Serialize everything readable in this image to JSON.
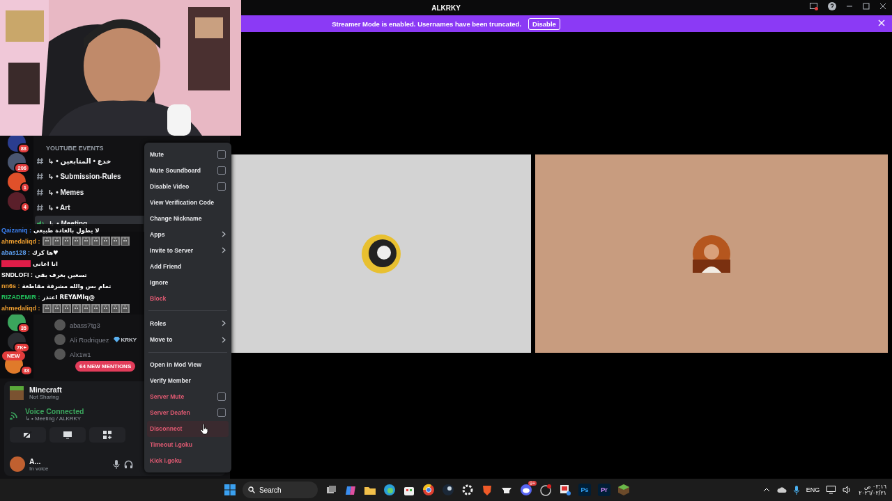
{
  "window": {
    "title": "ALKRKY"
  },
  "banner": {
    "text": "Streamer Mode is enabled. Usernames have been truncated.",
    "button": "Disable"
  },
  "servers": [
    {
      "badge": "88",
      "color": "#2a3d8f"
    },
    {
      "badge": "206",
      "color": "#4a5670"
    },
    {
      "badge": "1",
      "color": "#e0502a"
    },
    {
      "badge": "4",
      "color": "#5a1f2a"
    },
    {
      "badge": "35",
      "color": "#3ba55d"
    },
    {
      "badge": "7K+",
      "color": "#2b2d31"
    },
    {
      "badge": "33",
      "color": "#e07a2a",
      "pill": "NEW"
    }
  ],
  "channels": {
    "category": "YOUTUBE EVENTS",
    "items": [
      {
        "kind": "text",
        "name": "↳ • خدع • المتابعين",
        "selected": false
      },
      {
        "kind": "text",
        "name": "↳ • Submission-Rules",
        "selected": false
      },
      {
        "kind": "text",
        "name": "↳ • Memes",
        "selected": false
      },
      {
        "kind": "text",
        "name": "↳ • Art",
        "selected": false
      },
      {
        "kind": "voice",
        "name": "↳ • Meeting",
        "selected": true
      }
    ]
  },
  "members": [
    {
      "name": "abass7tg3"
    },
    {
      "name": "Ali Rodriquez",
      "tag": "KRKY"
    },
    {
      "name": "Alx1w1"
    }
  ],
  "mentions_pill": "64 NEW MENTIONS",
  "activity": {
    "title": "Minecraft",
    "subtitle": "Not Sharing"
  },
  "voice": {
    "status": "Voice Connected",
    "channel": "↳ • Meeting / ALKRKY"
  },
  "user": {
    "name": "A...",
    "status": "In voice"
  },
  "tiles": [
    {
      "color": "#d3d3d3"
    },
    {
      "color": "#c89c7f"
    }
  ],
  "context_menu": {
    "groups": [
      [
        {
          "label": "Mute",
          "kind": "checkbox",
          "checked": false,
          "danger": false,
          "hovered": false
        },
        {
          "label": "Mute Soundboard",
          "kind": "checkbox",
          "checked": false,
          "danger": false,
          "hovered": false
        },
        {
          "label": "Disable Video",
          "kind": "checkbox",
          "checked": false,
          "danger": false,
          "hovered": false
        },
        {
          "label": "View Verification Code",
          "kind": "action",
          "danger": false,
          "hovered": false
        },
        {
          "label": "Change Nickname",
          "kind": "action",
          "danger": false,
          "hovered": false
        },
        {
          "label": "Apps",
          "kind": "submenu",
          "danger": false,
          "hovered": false
        },
        {
          "label": "Invite to Server",
          "kind": "submenu",
          "danger": false,
          "hovered": false
        },
        {
          "label": "Add Friend",
          "kind": "action",
          "danger": false,
          "hovered": false
        },
        {
          "label": "Ignore",
          "kind": "action",
          "danger": false,
          "hovered": false
        },
        {
          "label": "Block",
          "kind": "action",
          "danger": true,
          "hovered": false
        }
      ],
      [
        {
          "label": "Roles",
          "kind": "submenu",
          "danger": false,
          "hovered": false
        },
        {
          "label": "Move to",
          "kind": "submenu",
          "danger": false,
          "hovered": false
        }
      ],
      [
        {
          "label": "Open in Mod View",
          "kind": "action",
          "danger": false,
          "hovered": false
        },
        {
          "label": "Verify Member",
          "kind": "action",
          "danger": false,
          "hovered": false
        },
        {
          "label": "Server Mute",
          "kind": "checkbox",
          "checked": false,
          "danger": true,
          "hovered": false
        },
        {
          "label": "Server Deafen",
          "kind": "checkbox",
          "checked": false,
          "danger": true,
          "hovered": false
        },
        {
          "label": "Disconnect",
          "kind": "action",
          "danger": true,
          "hovered": true
        },
        {
          "label": "Timeout i.goku",
          "kind": "action",
          "danger": true,
          "hovered": false
        },
        {
          "label": "Kick i.goku",
          "kind": "action",
          "danger": true,
          "hovered": false
        }
      ]
    ]
  },
  "chat": [
    {
      "user": "Qaizaniq :",
      "color": "#3b82f6",
      "kind": "text",
      "message": "لا يطول بالعادة طبيعي"
    },
    {
      "user": "ahmedaliqd :",
      "color": "#f0a030",
      "kind": "emotes"
    },
    {
      "user": "abas128 :",
      "color": "#60a5fa",
      "kind": "text",
      "message": "♥ها كرك"
    },
    {
      "color": "#e11d48",
      "kind": "text",
      "message": "انا اعاني"
    },
    {
      "user": "SNDLOFI :",
      "color": "#ffffff",
      "kind": "text",
      "message": "تسعين بعرف يقي"
    },
    {
      "user": "nn6s :",
      "color": "#f0a030",
      "kind": "text",
      "message": "تمام بس والله مشرفة مقاطعة"
    },
    {
      "user": "RIZADEMIR :",
      "color": "#22c55e",
      "kind": "text",
      "message": "@REYAMIq اعتذر"
    },
    {
      "user": "ahmedaliqd :",
      "color": "#f0a030",
      "kind": "emotes"
    }
  ],
  "taskbar": {
    "search": "Search",
    "badge": "9+",
    "app_labels": [
      "Ps",
      "Pr"
    ],
    "language": "ENG",
    "time": "٠٢:١٦ ص",
    "date": "٢٠٢٦/٠٢/٢١"
  }
}
